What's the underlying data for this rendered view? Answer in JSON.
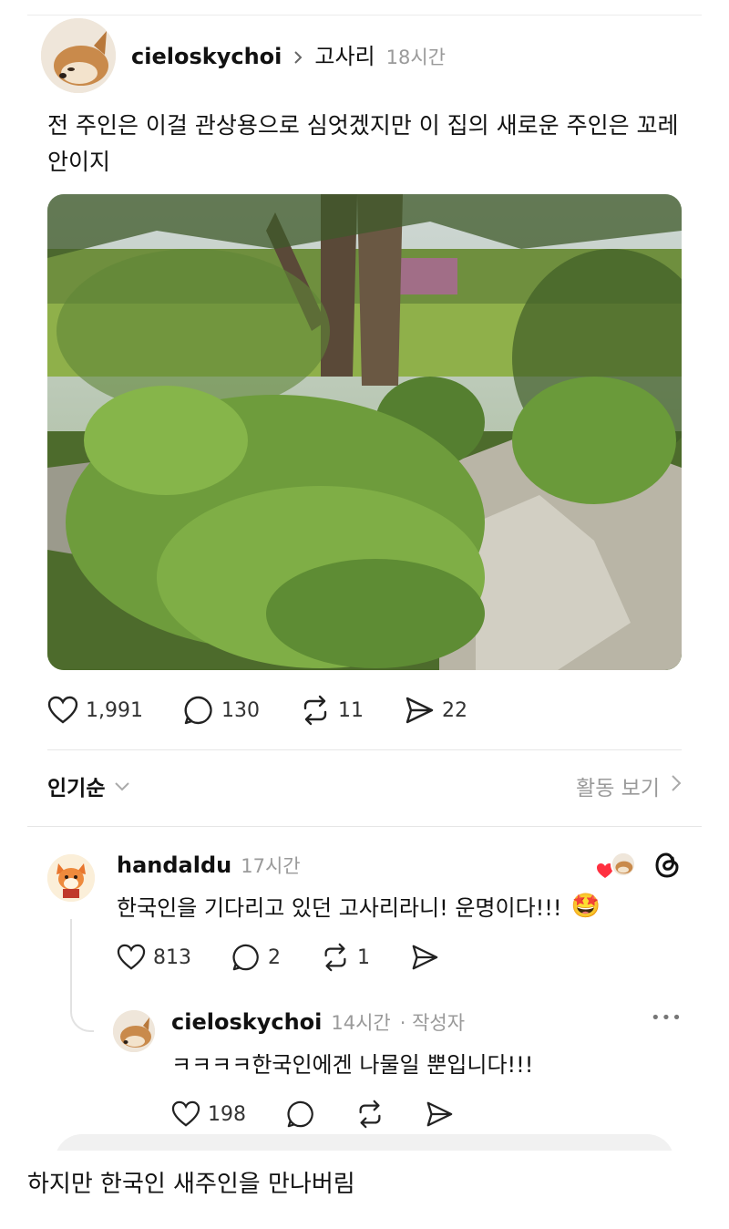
{
  "post": {
    "username": "cieloskychoi",
    "separator": ">",
    "topic": "고사리",
    "time": "18시간",
    "text": "전 주인은 이걸 관상용으로 심엇겠지만 이 집의 새로운 주인은 꼬레안이지",
    "image_alt": "fern-garden-photo",
    "stats": {
      "likes": "1,991",
      "comments": "130",
      "reposts": "11",
      "shares": "22"
    }
  },
  "sort": {
    "label": "인기순",
    "activity": "활동 보기"
  },
  "comment": {
    "username": "handaldu",
    "time": "17시간",
    "text": "한국인을 기다리고 있던 고사리라니! 운명이다!!!",
    "emoji": "🤩",
    "stats": {
      "likes": "813",
      "comments": "2",
      "reposts": "1"
    }
  },
  "reply": {
    "username": "cieloskychoi",
    "time": "14시간",
    "author_tag": "· 작성자",
    "more": "•••",
    "text": "ㅋㅋㅋㅋ한국인에겐 나물일 뿐입니다!!!",
    "stats": {
      "likes": "198"
    }
  },
  "caption": "하지만 한국인 새주인을 만나버림",
  "colors": {
    "text": "#111111",
    "muted": "#9a9a9a",
    "heart": "#ff3040",
    "divider": "#e6e6e6"
  }
}
